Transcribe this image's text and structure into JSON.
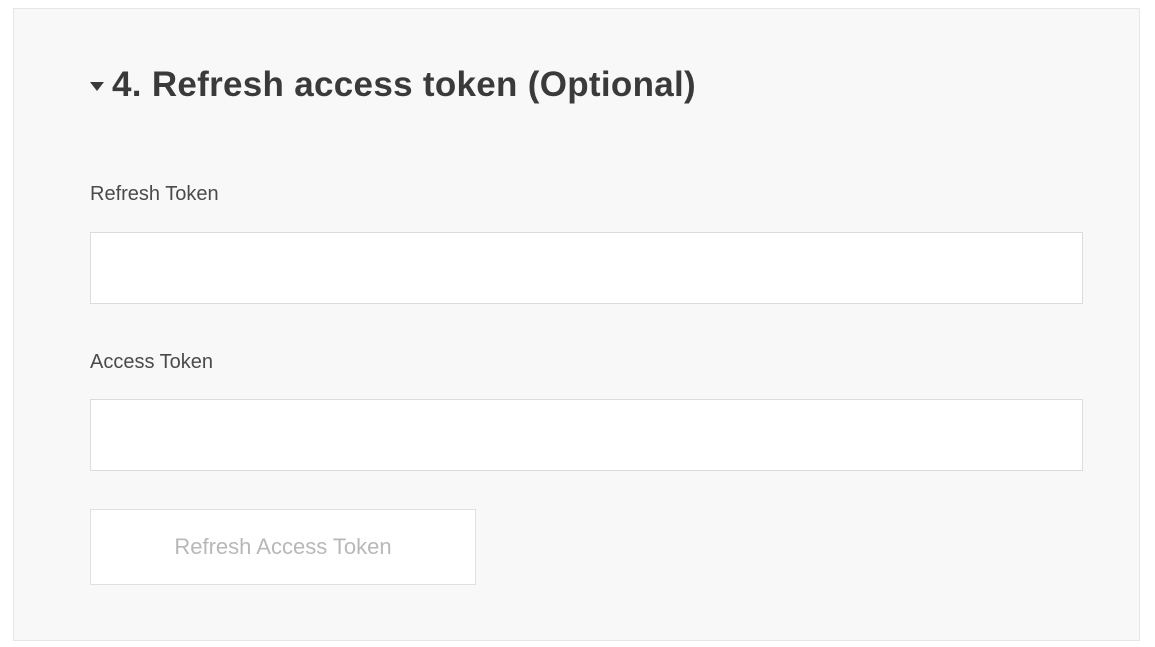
{
  "section": {
    "title": "4. Refresh access token (Optional)",
    "expanded": true,
    "caret_icon": "caret-down-icon"
  },
  "fields": {
    "refresh_token": {
      "label": "Refresh Token",
      "value": "",
      "placeholder": ""
    },
    "access_token": {
      "label": "Access Token",
      "value": "",
      "placeholder": ""
    }
  },
  "actions": {
    "refresh_button_label": "Refresh Access Token",
    "refresh_button_disabled": true
  },
  "colors": {
    "panel_background": "#f8f8f8",
    "title_text": "#3a3a3a",
    "disabled_text": "#b8b8b8"
  }
}
